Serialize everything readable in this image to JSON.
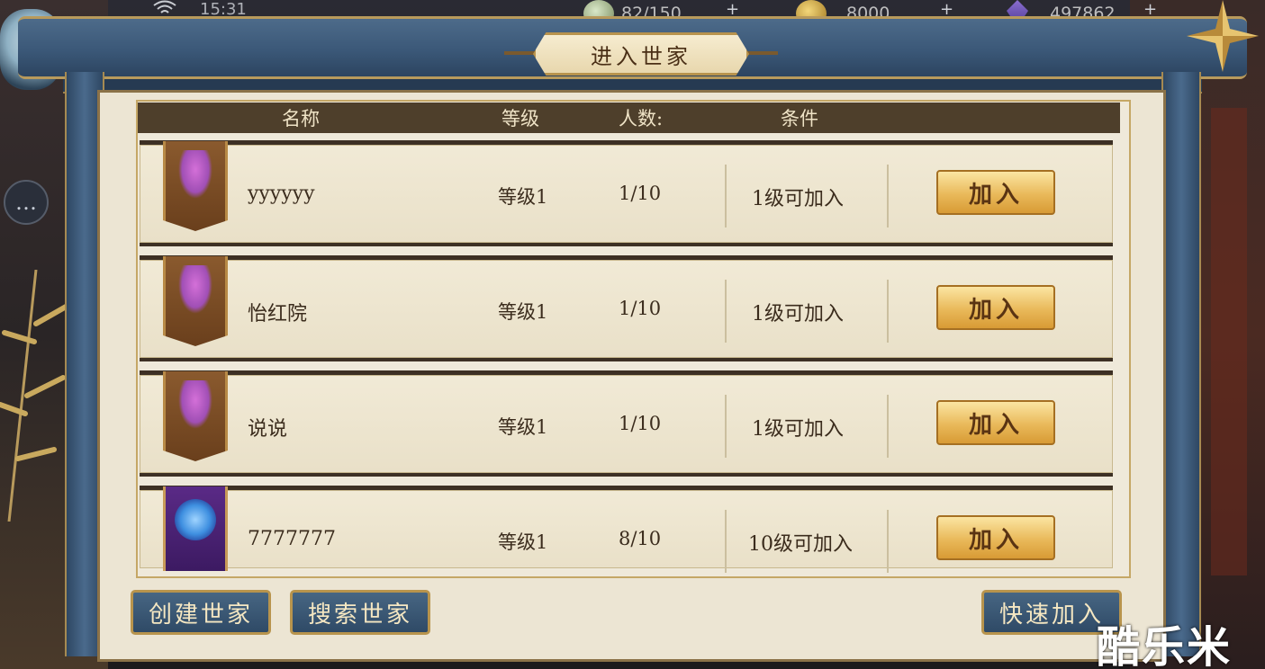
{
  "status_bar": {
    "time": "15:31"
  },
  "resources": [
    {
      "icon": "jade-icon",
      "value": "82/150"
    },
    {
      "icon": "gold-coin-icon",
      "value": "8000"
    },
    {
      "icon": "crystal-icon",
      "value": "497862"
    }
  ],
  "dialog": {
    "title": "进入世家"
  },
  "table": {
    "headers": {
      "name": "名称",
      "level": "等级",
      "members": "人数:",
      "condition": "条件"
    },
    "rows": [
      {
        "name": "yyyyyy",
        "level": "等级1",
        "members": "1/10",
        "condition": "1级可加入",
        "join_label": "加入",
        "banner": "purple-flower-banner"
      },
      {
        "name": "怡红院",
        "level": "等级1",
        "members": "1/10",
        "condition": "1级可加入",
        "join_label": "加入",
        "banner": "purple-flower-banner"
      },
      {
        "name": "说说",
        "level": "等级1",
        "members": "1/10",
        "condition": "1级可加入",
        "join_label": "加入",
        "banner": "purple-flower-banner"
      },
      {
        "name": "7777777",
        "level": "等级1",
        "members": "8/10",
        "condition": "10级可加入",
        "join_label": "加入",
        "banner": "blue-lotus-banner"
      }
    ]
  },
  "buttons": {
    "create": "创建世家",
    "search": "搜索世家",
    "quick_join": "快速加入"
  },
  "watermark": "酷乐米",
  "colors": {
    "frame_blue": "#3b5878",
    "gold_trim": "#b8934d",
    "join_button": "#e9b95a",
    "header_brown": "#4e3f2b"
  }
}
